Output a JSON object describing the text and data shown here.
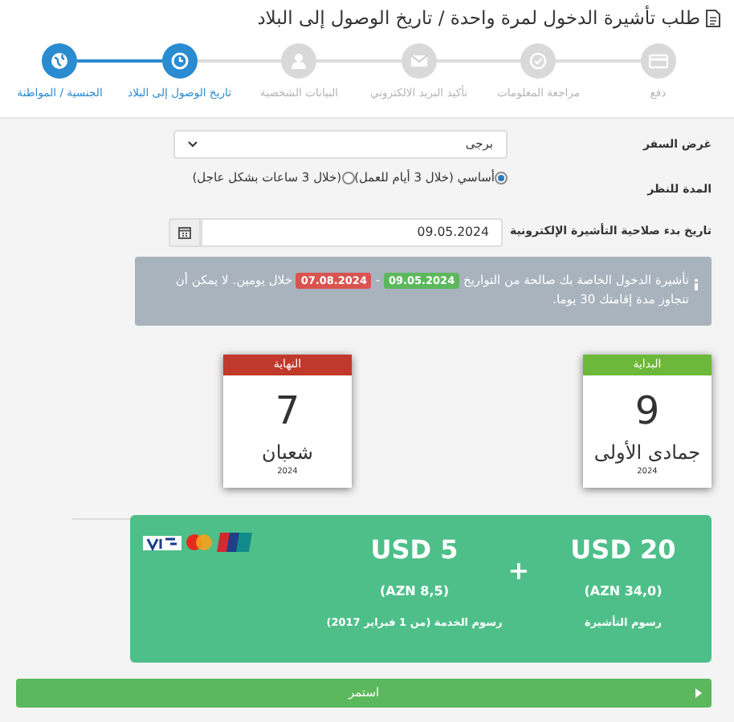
{
  "title": "طلب تأشيرة الدخول لمرة واحدة / تاريخ الوصول إلى البلاد",
  "steps": [
    {
      "label": "دفع",
      "kind": "card",
      "completed": false
    },
    {
      "label": "مراجعة المعلومات",
      "kind": "check",
      "completed": false
    },
    {
      "label": "تأكيد البريد الالكتروني",
      "kind": "envelope",
      "completed": false
    },
    {
      "label": "البيانات الشخصية",
      "kind": "user",
      "completed": false
    },
    {
      "label": "تاريخ الوصول إلى البلاد",
      "kind": "clock",
      "completed": true
    },
    {
      "label": "الجنسية / المواطنة",
      "kind": "globe",
      "completed": true
    }
  ],
  "purpose": {
    "label": "غرض السفر",
    "value": "برجى"
  },
  "processing": {
    "label": "المدة للنظر",
    "options": [
      {
        "label": "أساسي (خلال 3 أيام للعمل)",
        "selected": true
      },
      {
        "label": "(خلال 3 ساعات بشكل عاجل)",
        "selected": false
      }
    ]
  },
  "start_date": {
    "label": "تاريخ بدء صلاحية التأشيرة الإلكترونية",
    "value": "09.05.2024"
  },
  "notice": {
    "before": "تأشيرة الدخول الخاصة بك صالحة من التواريخ",
    "from": "09.05.2024",
    "dash": "-",
    "to": "07.08.2024",
    "after": "خلال يومين. لا يمكن أن تتجاوز مدة إقامتك 30 يوما."
  },
  "calendars": [
    {
      "header": "البداية",
      "day": "9",
      "month": "جمادى الأولى",
      "year": "2024",
      "color": "#6cb83a"
    },
    {
      "header": "النهاية",
      "day": "7",
      "month": "شعبان",
      "year": "2024",
      "color": "#c0392b"
    }
  ],
  "fees": [
    {
      "amount": "USD 20",
      "local": "(AZN 34,0)",
      "label": "رسوم التأشيرة"
    },
    {
      "amount": "USD 5",
      "local": "(AZN 8,5)",
      "label": "رسوم الخدمة (من 1 فبراير 2017)"
    }
  ],
  "fee_separator": "+",
  "continue_button": "استمر"
}
